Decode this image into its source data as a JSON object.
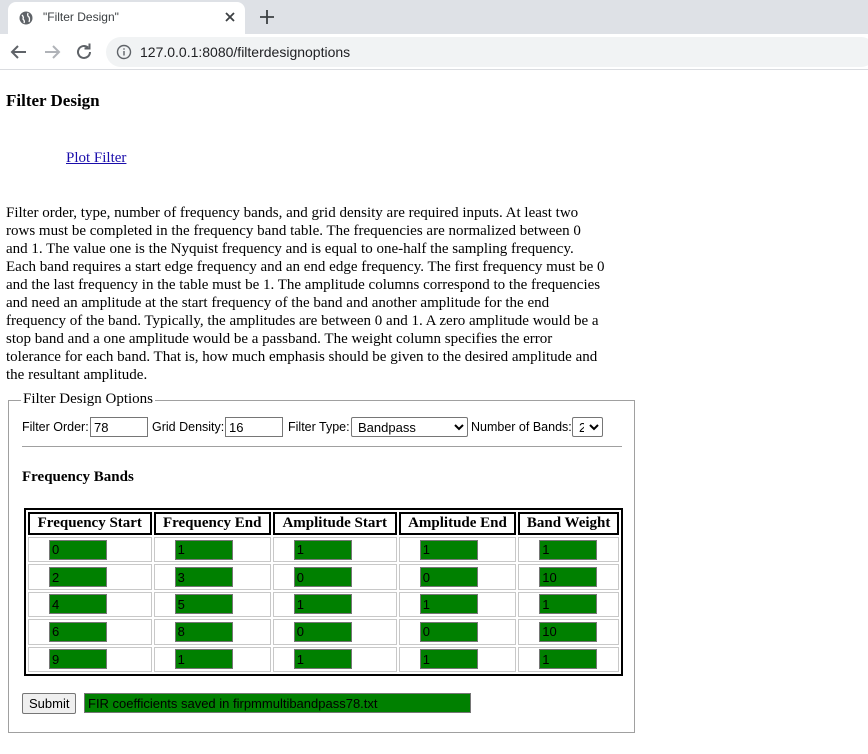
{
  "browser": {
    "tab_title": "\"Filter Design\"",
    "url": "127.0.0.1:8080/filterdesignoptions"
  },
  "page": {
    "title": "Filter Design",
    "plot_link": "Plot Filter",
    "description": "Filter order, type, number of frequency bands, and grid density are required inputs. At least two rows must be completed in the frequency band table. The frequencies are normalized between 0 and 1. The value one is the Nyquist frequency and is equal to one-half the sampling frequency. Each band requires a start edge frequency and an end edge frequency. The first frequency must be 0 and the last frequency in the table must be 1. The amplitude columns correspond to the frequencies and need an amplitude at the start frequency of the band and another amplitude for the end frequency of the band. Typically, the amplitudes are between 0 and 1. A zero amplitude would be a stop band and a one amplitude would be a passband. The weight column specifies the error tolerance for each band. That is, how much emphasis should be given to the desired amplitude and the resultant amplitude."
  },
  "options": {
    "legend": "Filter Design Options",
    "filter_order_label": "Filter Order:",
    "filter_order": "78",
    "grid_density_label": "Grid Density:",
    "grid_density": "16",
    "filter_type_label": "Filter Type:",
    "filter_type": "Bandpass",
    "num_bands_label": "Number of Bands:",
    "num_bands": "2"
  },
  "bands": {
    "heading": "Frequency Bands",
    "columns": [
      "Frequency Start",
      "Frequency End",
      "Amplitude Start",
      "Amplitude End",
      "Band Weight"
    ],
    "rows": [
      [
        "0",
        "1",
        "1",
        "1",
        "1"
      ],
      [
        "2",
        "3",
        "0",
        "0",
        "10"
      ],
      [
        "4",
        "5",
        "1",
        "1",
        "1"
      ],
      [
        "6",
        "8",
        "0",
        "0",
        "10"
      ],
      [
        "9",
        "1",
        "1",
        "1",
        "1"
      ]
    ]
  },
  "submit_label": "Submit",
  "status": "FIR coefficients saved in firpmmultibandpass78.txt",
  "colors": {
    "input_fill": "#008000",
    "link": "#1a0dab",
    "tabstrip": "#dee1e6"
  }
}
